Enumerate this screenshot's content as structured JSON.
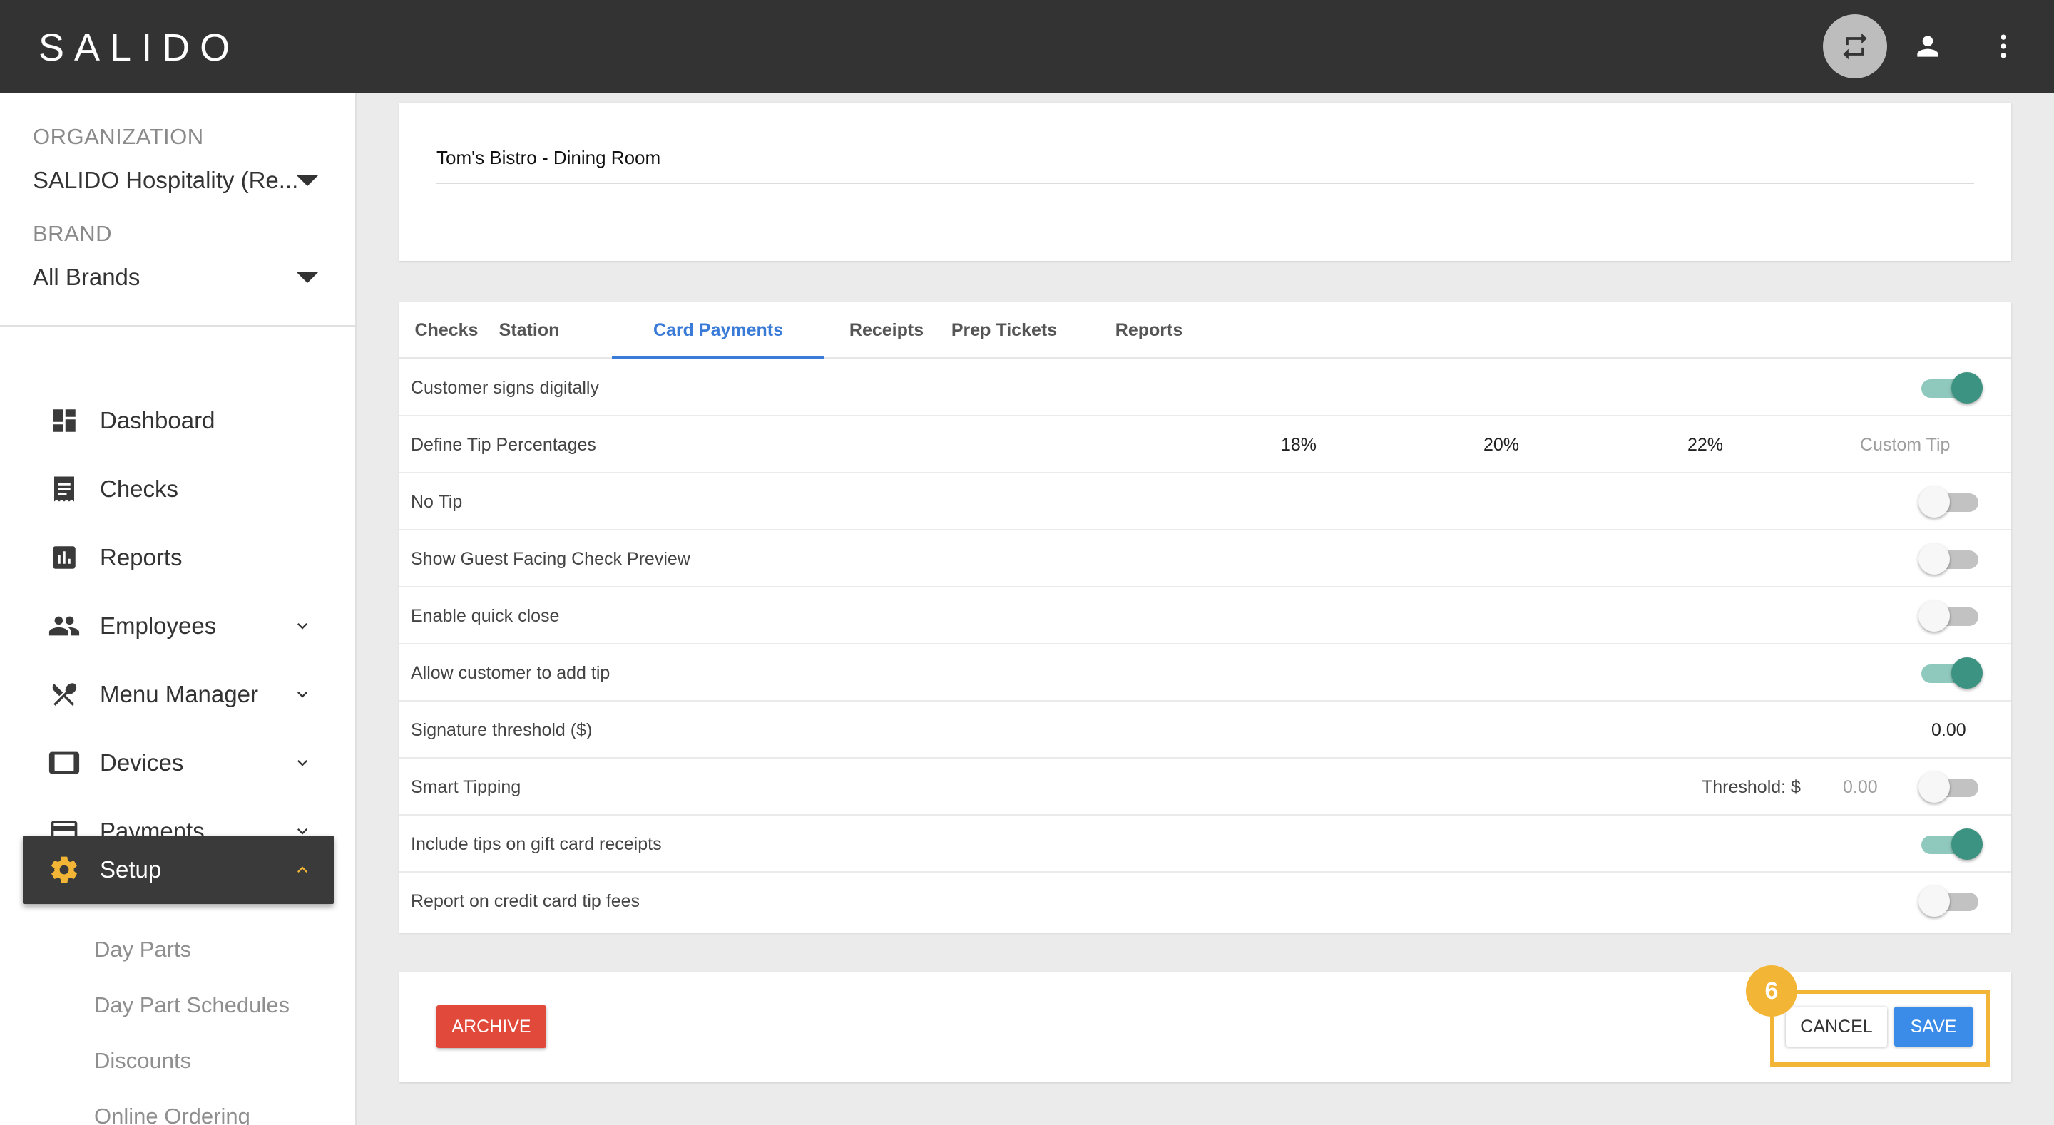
{
  "app": {
    "logo": "SALIDO"
  },
  "topbar": {
    "swap_icon": "swap-icon",
    "user_icon": "person-icon",
    "more_icon": "more-vert-icon"
  },
  "sidebar": {
    "organization_label": "ORGANIZATION",
    "organization_value": "SALIDO Hospitality (Re...",
    "brand_label": "BRAND",
    "brand_value": "All Brands",
    "items": [
      {
        "label": "Dashboard",
        "icon": "dashboard-icon"
      },
      {
        "label": "Checks",
        "icon": "receipt-icon"
      },
      {
        "label": "Reports",
        "icon": "bar-chart-icon"
      },
      {
        "label": "Employees",
        "icon": "people-icon"
      },
      {
        "label": "Menu Manager",
        "icon": "utensils-icon"
      },
      {
        "label": "Devices",
        "icon": "tablet-icon"
      },
      {
        "label": "Payments",
        "icon": "credit-card-icon"
      },
      {
        "label": "Setup",
        "icon": "gear-icon"
      }
    ],
    "sub_items": [
      "Day Parts",
      "Day Part Schedules",
      "Discounts",
      "Online Ordering"
    ]
  },
  "name_card": {
    "value": "Tom's Bistro - Dining Room"
  },
  "tabs": [
    "Checks",
    "Station",
    "Card Payments",
    "Receipts",
    "Prep Tickets",
    "Reports"
  ],
  "active_tab": "Card Payments",
  "settings": {
    "rows": [
      {
        "label": "Customer signs digitally",
        "toggle": true
      },
      {
        "label": "Define Tip Percentages"
      },
      {
        "label": "No Tip",
        "toggle": false
      },
      {
        "label": "Show Guest Facing Check Preview",
        "toggle": false
      },
      {
        "label": "Enable quick close",
        "toggle": false
      },
      {
        "label": "Allow customer to add tip",
        "toggle": true
      },
      {
        "label": "Signature threshold ($)"
      },
      {
        "label": "Smart Tipping",
        "toggle": false
      },
      {
        "label": "Include tips on gift card receipts",
        "toggle": true
      },
      {
        "label": "Report on credit card tip fees",
        "toggle": false
      }
    ],
    "tip_percentages": [
      "18%",
      "20%",
      "22%"
    ],
    "custom_tip_placeholder": "Custom Tip",
    "signature_threshold": "0.00",
    "smart_tipping_label": "Threshold: $",
    "smart_tipping_value": "0.00"
  },
  "actions": {
    "archive": "ARCHIVE",
    "cancel": "CANCEL",
    "save": "SAVE"
  },
  "annotation": {
    "step": "6",
    "color": "#f3b536"
  },
  "colors": {
    "accent": "#3b7bd8",
    "toggle_on": "#3d9382",
    "archive": "#e14a3b",
    "save": "#3b8ce8",
    "topbar": "#333333"
  }
}
